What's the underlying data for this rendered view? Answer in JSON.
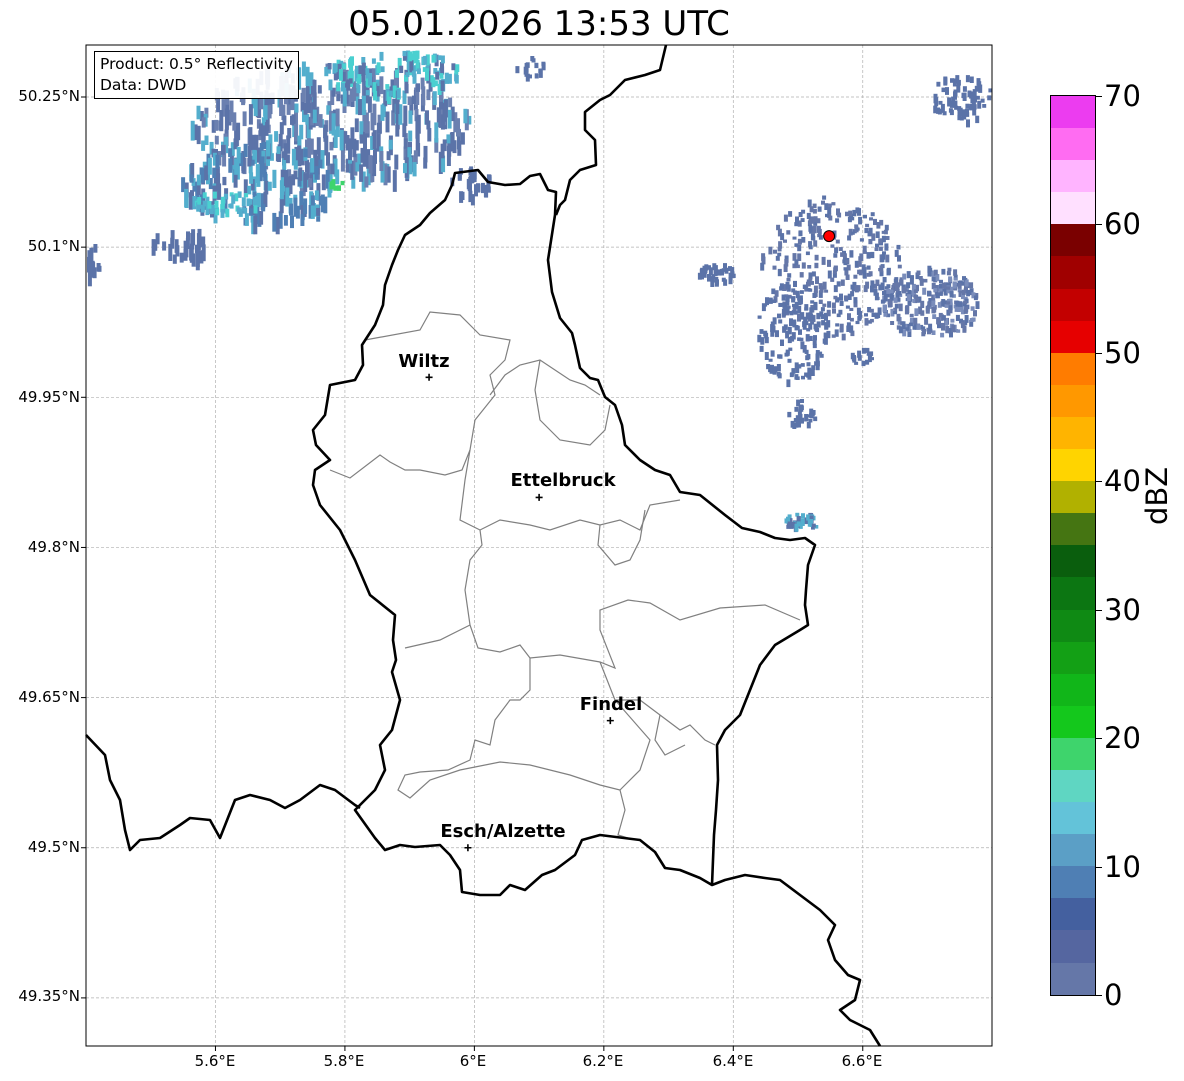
{
  "title": "05.01.2026 13:53 UTC",
  "product_box": {
    "line1": "Product: 0.5° Reflectivity",
    "line2": "Data: DWD"
  },
  "lat_ticks": [
    "50.25°N",
    "50.1°N",
    "49.95°N",
    "49.8°N",
    "49.65°N",
    "49.5°N",
    "49.35°N"
  ],
  "lon_ticks": [
    "5.6°E",
    "5.8°E",
    "6°E",
    "6.2°E",
    "6.4°E",
    "6.6°E"
  ],
  "cities": [
    {
      "name": "Wiltz",
      "lon": 5.93,
      "lat": 49.97
    },
    {
      "name": "Ettelbruck",
      "lon": 6.1,
      "lat": 49.85
    },
    {
      "name": "Findel",
      "lon": 6.21,
      "lat": 49.627
    },
    {
      "name": "Esch/Alzette",
      "lon": 5.99,
      "lat": 49.5
    }
  ],
  "radar_site": {
    "lon": 6.548,
    "lat": 50.111,
    "color": "#ff0000"
  },
  "colorbar": {
    "label": "dBZ",
    "ticks": [
      "0",
      "10",
      "20",
      "30",
      "40",
      "50",
      "60",
      "70"
    ],
    "min": 0,
    "max": 70,
    "step": 2.5,
    "colors": [
      "#6577a8",
      "#5566a0",
      "#44609f",
      "#4f7fb4",
      "#5b9fc6",
      "#63c3d9",
      "#5fd6c2",
      "#3ed46c",
      "#14c81c",
      "#11b619",
      "#13a015",
      "#0f8a14",
      "#0c7612",
      "#0a5e0d",
      "#457512",
      "#b1b100",
      "#ffd400",
      "#ffb400",
      "#ff9800",
      "#ff7c00",
      "#e60000",
      "#c30000",
      "#a00000",
      "#7a0000",
      "#ffe0ff",
      "#ffb4ff",
      "#ff6cf2",
      "#ec3cf0"
    ]
  },
  "map_colors": {
    "border": "#000000",
    "districts": "#808080",
    "grid": "#b0b0b0",
    "echo_main": "#5b73a8",
    "echo_light": "#53aecd",
    "echo_cyan": "#4ad0d0"
  }
}
